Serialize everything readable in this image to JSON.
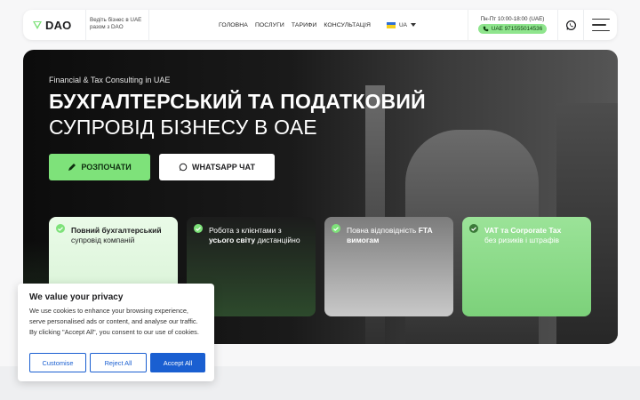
{
  "header": {
    "logo": "DAO",
    "tagline": "Ведіть бізнес в UAE разом з DAO",
    "nav": [
      "ГОЛОВНА",
      "ПОСЛУГИ",
      "ТАРИФИ",
      "КОНСУЛЬТАЦІЯ"
    ],
    "lang": "UA",
    "hours": "Пн-Пт 10:00-18:00 (UAE)",
    "phone": "UAE 971555014536"
  },
  "hero": {
    "subtitle": "Financial & Tax Consulting in UAE",
    "title_line1": "БУХГАЛТЕРСЬКИЙ ТА ПОДАТКОВИЙ",
    "title_line2": "СУПРОВІД БІЗНЕСУ В ОАЕ",
    "btn_start": "РОЗПОЧАТИ",
    "btn_whatsapp": "WHATSAPP ЧАТ"
  },
  "cards": [
    {
      "bold": "Повний бухгалтерський",
      "rest": "супровід компаній"
    },
    {
      "pre": "Робота з клієнтами з",
      "bold": "усього світу",
      "rest": "дистанційно"
    },
    {
      "pre": "Повна відповідність",
      "bold": "FTA вимогам"
    },
    {
      "bold": "VAT та Corporate Tax",
      "rest": "без ризиків і штрафів"
    }
  ],
  "consent": {
    "title": "We value your privacy",
    "body": "We use cookies to enhance your browsing experience, serve personalised ads or content, and analyse our traffic. By clicking \"Accept All\", you consent to our use of cookies.",
    "customise": "Customise",
    "reject": "Reject All",
    "accept": "Accept All"
  },
  "colors": {
    "accent": "#7ee27a",
    "consent_blue": "#1a5fd1"
  }
}
